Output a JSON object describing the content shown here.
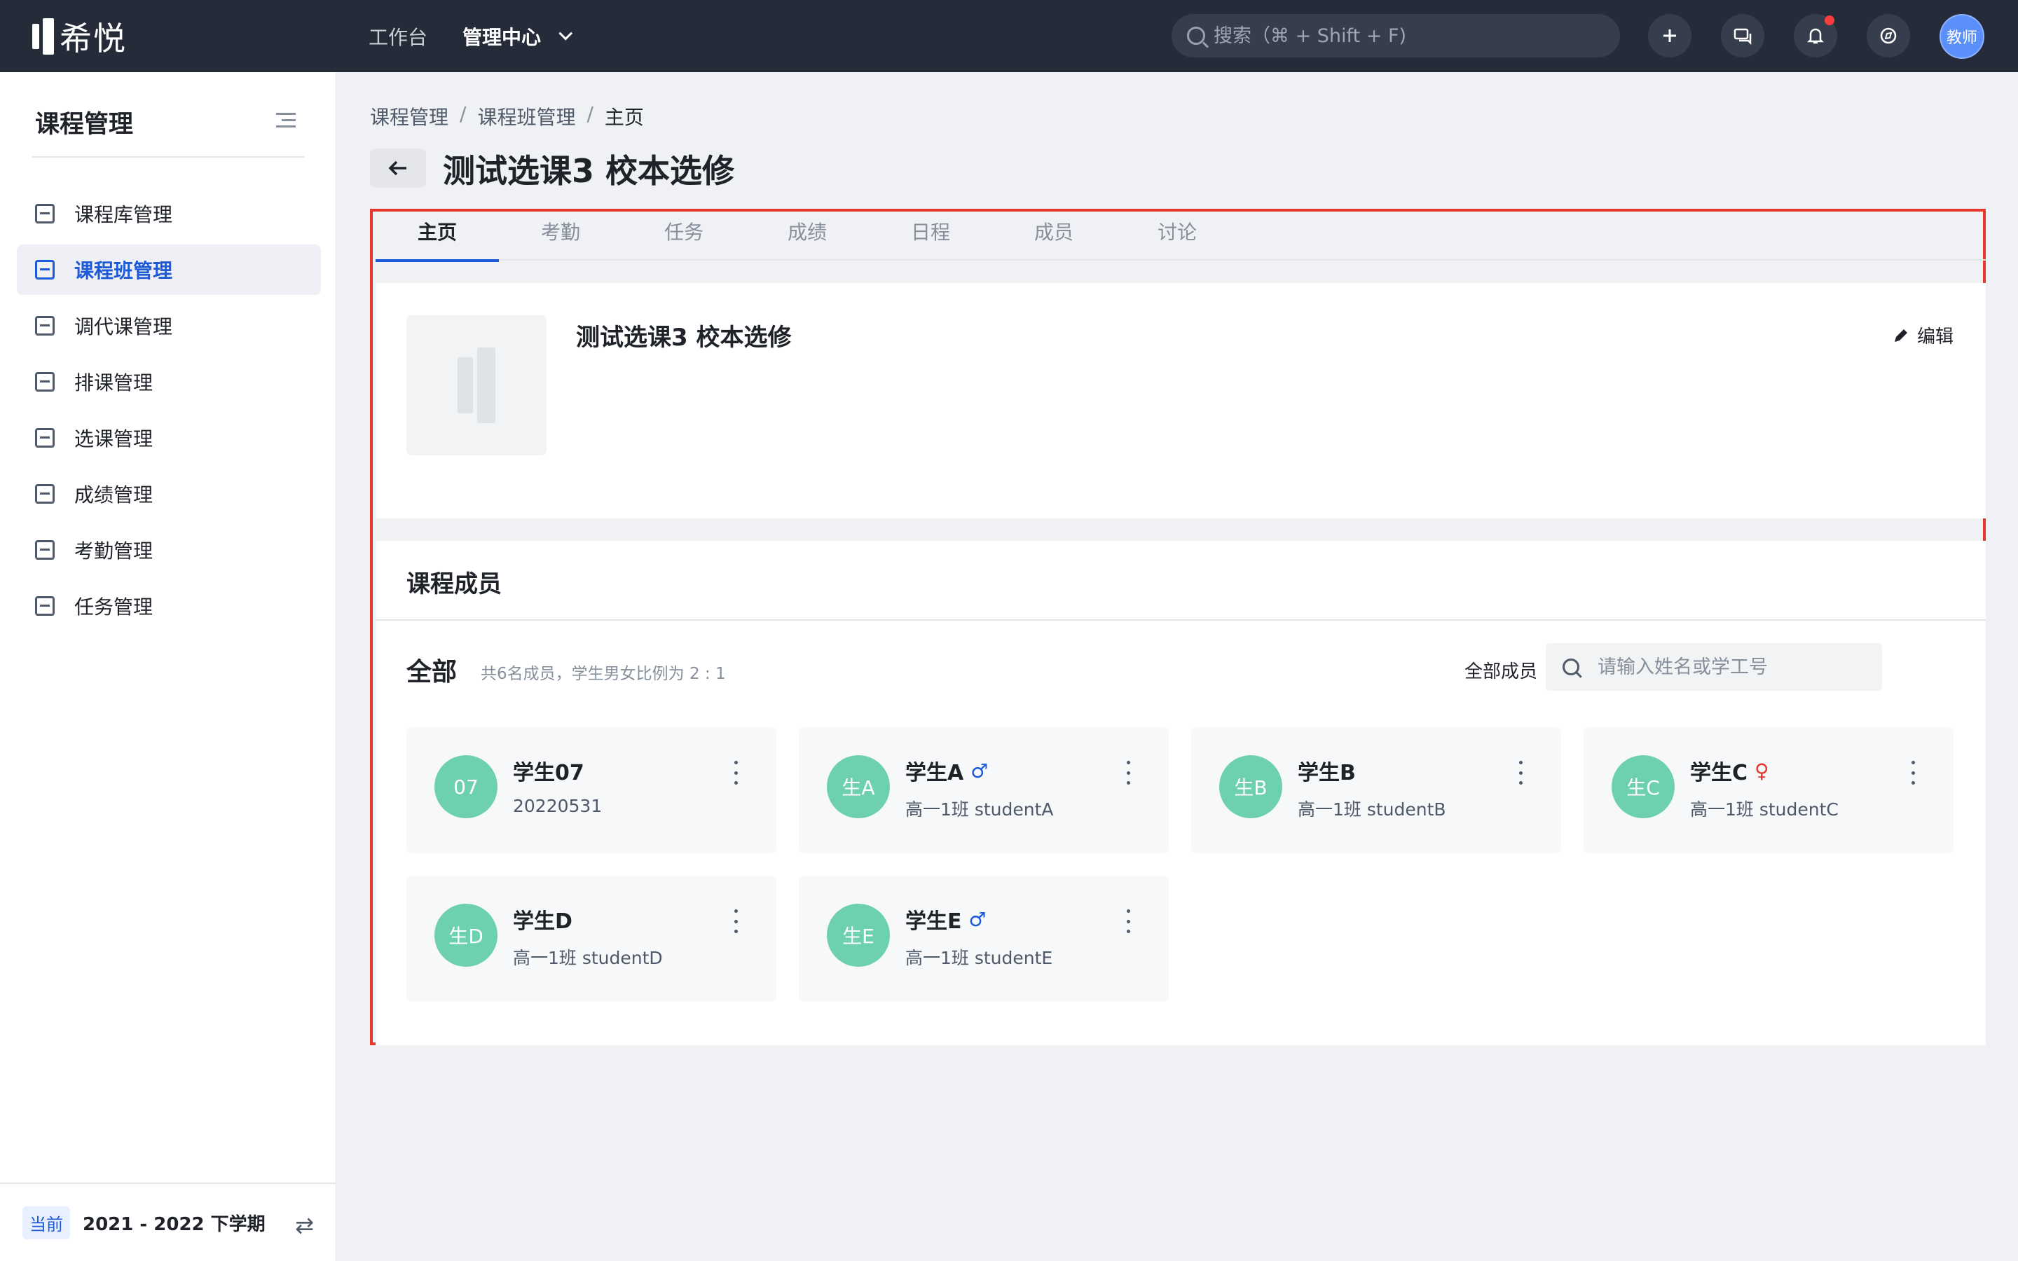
{
  "app": {
    "logo_text": "希悦"
  },
  "topnav": {
    "workspace": "工作台",
    "admin": "管理中心"
  },
  "search": {
    "placeholder": "搜索（⌘ + Shift + F)"
  },
  "user": {
    "avatar_text": "教师"
  },
  "sidebar": {
    "title": "课程管理",
    "items": [
      {
        "label": "课程库管理",
        "icon": "stack-icon"
      },
      {
        "label": "课程班管理",
        "icon": "class-icon",
        "active": true
      },
      {
        "label": "调代课管理",
        "icon": "substitute-icon"
      },
      {
        "label": "排课管理",
        "icon": "schedule-icon"
      },
      {
        "label": "选课管理",
        "icon": "checklist-icon"
      },
      {
        "label": "成绩管理",
        "icon": "grade-icon"
      },
      {
        "label": "考勤管理",
        "icon": "calendar-check-icon"
      },
      {
        "label": "任务管理",
        "icon": "task-list-icon"
      }
    ],
    "term_badge": "当前",
    "term": "2021 - 2022 下学期"
  },
  "breadcrumb": {
    "c1": "课程管理",
    "c2": "课程班管理",
    "c3": "主页",
    "sep": "/"
  },
  "page": {
    "title": "测试选课3 校本选修"
  },
  "tabs": [
    "主页",
    "考勤",
    "任务",
    "成绩",
    "日程",
    "成员",
    "讨论"
  ],
  "course": {
    "name": "测试选课3 校本选修",
    "edit_label": "编辑"
  },
  "members": {
    "title": "课程成员",
    "filter_label": "全部",
    "summary": "共6名成员，学生男女比例为 2 : 1",
    "select_label": "全部成员",
    "search_placeholder": "请输入姓名或学工号",
    "list": [
      {
        "avatar": "07",
        "name": "学生07",
        "gender": "",
        "sub": "20220531"
      },
      {
        "avatar": "生A",
        "name": "学生A",
        "gender": "♂",
        "sub": "高一1班 studentA"
      },
      {
        "avatar": "生B",
        "name": "学生B",
        "gender": "",
        "sub": "高一1班 studentB"
      },
      {
        "avatar": "生C",
        "name": "学生C",
        "gender": "♀",
        "sub": "高一1班 studentC"
      },
      {
        "avatar": "生D",
        "name": "学生D",
        "gender": "",
        "sub": "高一1班 studentD"
      },
      {
        "avatar": "生E",
        "name": "学生E",
        "gender": "♂",
        "sub": "高一1班 studentE"
      }
    ]
  },
  "colors": {
    "accent": "#1c5ad8",
    "topbar": "#252b38",
    "avatar": "#6dd1b0",
    "highlight_border": "#e5372a"
  }
}
